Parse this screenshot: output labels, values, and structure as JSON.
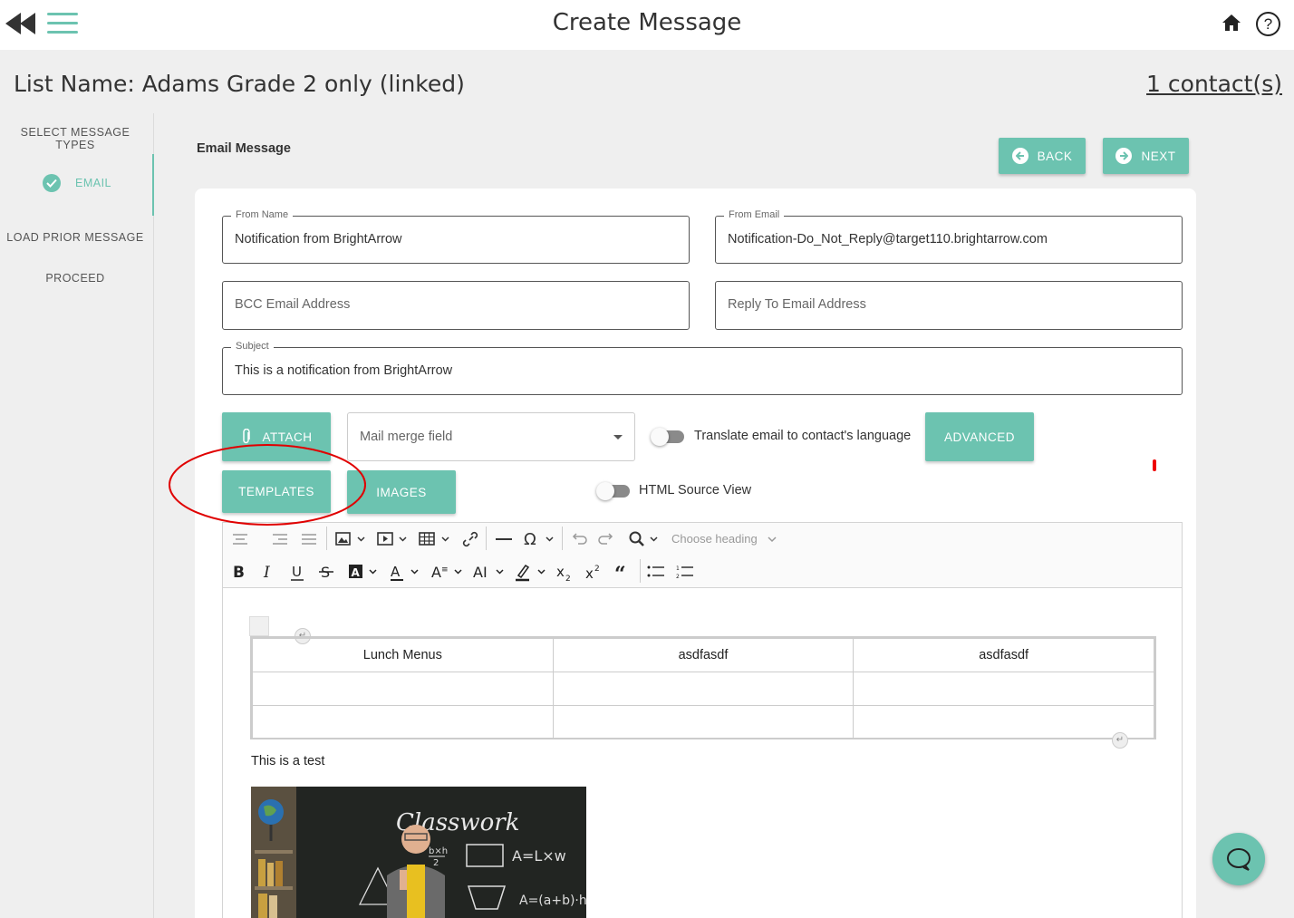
{
  "header": {
    "title": "Create Message"
  },
  "list": {
    "name": "List Name: Adams Grade 2 only (linked)",
    "contacts": "1 contact(s)"
  },
  "sidebar": {
    "heading": "SELECT MESSAGE TYPES",
    "email": "EMAIL",
    "load_prior": "LOAD PRIOR MESSAGE",
    "proceed": "PROCEED"
  },
  "section": {
    "title": "Email Message",
    "back": "BACK",
    "next": "NEXT"
  },
  "form": {
    "from_name_label": "From Name",
    "from_name_value": "Notification from BrightArrow",
    "from_email_label": "From Email",
    "from_email_value": "Notification-Do_Not_Reply@target110.brightarrow.com",
    "bcc_placeholder": "BCC Email Address",
    "reply_placeholder": "Reply To Email Address",
    "subject_label": "Subject",
    "subject_value": "This is a notification from BrightArrow"
  },
  "actions": {
    "attach": "ATTACH",
    "mail_merge": "Mail merge field",
    "translate_label": "Translate email to contact's language",
    "translate_on": false,
    "advanced": "ADVANCED",
    "templates": "TEMPLATES",
    "images": "IMAGES",
    "html_source_label": "HTML Source View",
    "html_source_on": false
  },
  "editor": {
    "heading_select": "Choose heading",
    "table": {
      "rows": [
        [
          "Lunch Menus",
          "asdfasdf",
          "asdfasdf"
        ],
        [
          "",
          "",
          ""
        ],
        [
          "",
          "",
          ""
        ]
      ]
    },
    "paragraph": "This is a test",
    "image_caption_text": "Classwork"
  },
  "colors": {
    "accent": "#6cc3b0",
    "annotation": "#e00000"
  }
}
